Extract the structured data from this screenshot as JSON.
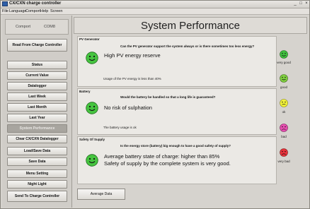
{
  "window": {
    "title": "CX/CXN charge controller",
    "minimize": "_",
    "maximize": "□",
    "close": "×"
  },
  "menu": [
    "File",
    "Language",
    "Comport",
    "Help",
    "Screen"
  ],
  "sidebar": {
    "comport_label": "Comport",
    "comport_value": "COM8",
    "buttons": [
      "Read From Charge Controller",
      "Status",
      "Current Value",
      "Datalogger",
      "Last Week",
      "Last Month",
      "Last Year",
      "System Performance",
      "Clear CX/CXN Datalogger",
      "Load/Save Data",
      "Save Data",
      "Menu Setting",
      "Night Light",
      "Send To Charge Controller"
    ]
  },
  "main": {
    "title": "System Performance",
    "panels": [
      {
        "title": "PV Generator",
        "question": "Can the PV generator support the system always or is there sometimes too less energy?",
        "answer": "High PV energy reserve",
        "detail": "Usage of the PV energy is less than 40%"
      },
      {
        "title": "Battery",
        "question": "Would the battery be handled so that a long life is guaranteed?",
        "answer": "No risk of sulphation",
        "detail": "The battery usage is ok"
      },
      {
        "title": "Safety Of Supply",
        "question": "Is the energy store (battery) big enough to have a good safety of supply?",
        "answer_line1": "Average battery state of charge: higher than 85%",
        "answer_line2": "Safety of supply by the complete system is very good."
      }
    ],
    "legend": [
      {
        "label": "very good",
        "color": "#3fbf3f"
      },
      {
        "label": "good",
        "color": "#7fcf3f"
      },
      {
        "label": "ok",
        "color": "#f2f23a"
      },
      {
        "label": "bad",
        "color": "#e64fb0"
      },
      {
        "label": "very bad",
        "color": "#e8323a"
      }
    ],
    "average_button": "Average Data"
  }
}
